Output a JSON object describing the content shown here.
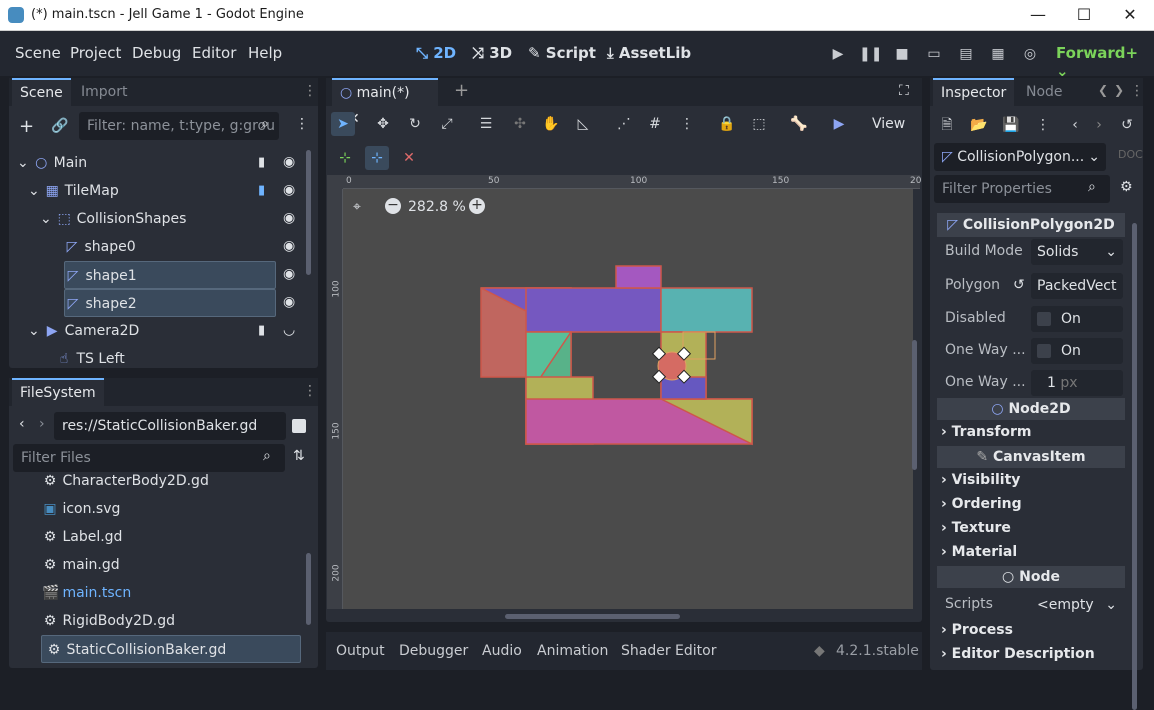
{
  "window": {
    "title": "(*) main.tscn - Jell Game 1 - Godot Engine",
    "minimize": "—",
    "maximize": "☐",
    "close": "✕"
  },
  "menu": {
    "items": [
      "Scene",
      "Project",
      "Debug",
      "Editor",
      "Help"
    ]
  },
  "workspaces": {
    "two_d": "2D",
    "three_d": "3D",
    "script": "Script",
    "assetlib": "AssetLib"
  },
  "renderer": "Forward+",
  "scene_dock": {
    "tabs": [
      "Scene",
      "Import"
    ],
    "filter_placeholder": "Filter: name, t:type, g:grou",
    "nodes": [
      "Main",
      "TileMap",
      "CollisionShapes",
      "shape0",
      "shape1",
      "shape2",
      "Camera2D",
      "TS Left"
    ]
  },
  "filesystem": {
    "tab": "FileSystem",
    "path": "res://StaticCollisionBaker.gd",
    "filter_placeholder": "Filter Files",
    "files": [
      "CharacterBody2D.gd",
      "icon.svg",
      "Label.gd",
      "main.gd",
      "main.tscn",
      "RigidBody2D.gd",
      "StaticCollisionBaker.gd"
    ]
  },
  "editor": {
    "tab": "main(*)",
    "view_menu": "View",
    "zoom": "282.8 %",
    "ruler_h": [
      "0",
      "50",
      "100",
      "150",
      "20"
    ],
    "ruler_v": [
      "100",
      "150",
      "200"
    ]
  },
  "bottom_panel": {
    "tabs": [
      "Output",
      "Debugger",
      "Audio",
      "Animation",
      "Shader Editor"
    ],
    "version": "4.2.1.stable"
  },
  "inspector": {
    "tabs": [
      "Inspector",
      "Node"
    ],
    "object": "CollisionPolygon...",
    "filter_placeholder": "Filter Properties",
    "class_header": "CollisionPolygon2D",
    "props": [
      {
        "label": "Build Mode",
        "value": "Solids"
      },
      {
        "label": "Polygon",
        "value": "PackedVect"
      },
      {
        "label": "Disabled",
        "value": "On"
      },
      {
        "label": "One Way ...",
        "value": "On"
      },
      {
        "label": "One Way ...",
        "value": "1",
        "unit": "px"
      }
    ],
    "node2d": "Node2D",
    "transform": "Transform",
    "canvasitem": "CanvasItem",
    "groups": [
      "Visibility",
      "Ordering",
      "Texture",
      "Material"
    ],
    "node": "Node",
    "scripts_label": "Scripts",
    "scripts_value": "<empty",
    "process": "Process",
    "editor_desc": "Editor Description"
  },
  "colors": {
    "accent": "#6fb4ff",
    "selection": "#3a4a5c",
    "viewport": "#4b4b4b",
    "renderer": "#7bd35a"
  }
}
